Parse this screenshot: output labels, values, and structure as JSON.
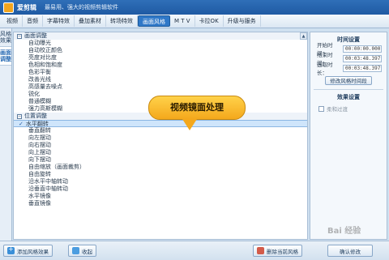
{
  "app": {
    "name": "爱剪辑",
    "slogan": "最易用、强大的视频剪辑软件"
  },
  "menu": [
    "视频",
    "音频",
    "字幕特效",
    "叠加素材",
    "转场特效",
    "画面风格",
    "M T V",
    "卡拉OK",
    "升级与服务"
  ],
  "menu_active_index": 5,
  "left_tabs": [
    {
      "label": "风格效果",
      "active": false
    },
    {
      "label": "画面调整",
      "active": true
    }
  ],
  "groups": [
    {
      "title": "画面调整",
      "items": [
        "自动曝光",
        "自动校正颜色",
        "亮度对比度",
        "色相和饱和度",
        "色彩平衡",
        "改善光线",
        "高感量去噪点",
        "锐化",
        "普通模糊",
        "强力高斯模糊"
      ]
    },
    {
      "title": "位置调整",
      "items": [
        "水平翻转",
        "垂直翻转",
        "向左摆动",
        "向右摆动",
        "向上摆动",
        "向下摆动",
        "自由缩放（画面裁剪）",
        "自由旋转",
        "沿水平中轴转动",
        "沿垂直中轴转动",
        "水平镜像",
        "垂直镜像"
      ],
      "selected_index": 0
    }
  ],
  "callout": "视频镜面处理",
  "time_settings": {
    "title": "时间设置",
    "start_label": "开始时间：",
    "start_value": "00:00:00.000",
    "end_label": "结束时间：",
    "end_value": "00:03:48.397",
    "duration_label": "选取时长：",
    "duration_value": "00:03:48.397",
    "button": "修改风格时间段"
  },
  "effect_settings": {
    "title": "效果设置",
    "checkbox_label": "柔和过渡"
  },
  "bottom": {
    "add_button": "添加风格效果",
    "fav_button": "收起",
    "delete_button": "删除当前风格",
    "confirm_button": "确认修改"
  },
  "watermark": "Bai 经验"
}
